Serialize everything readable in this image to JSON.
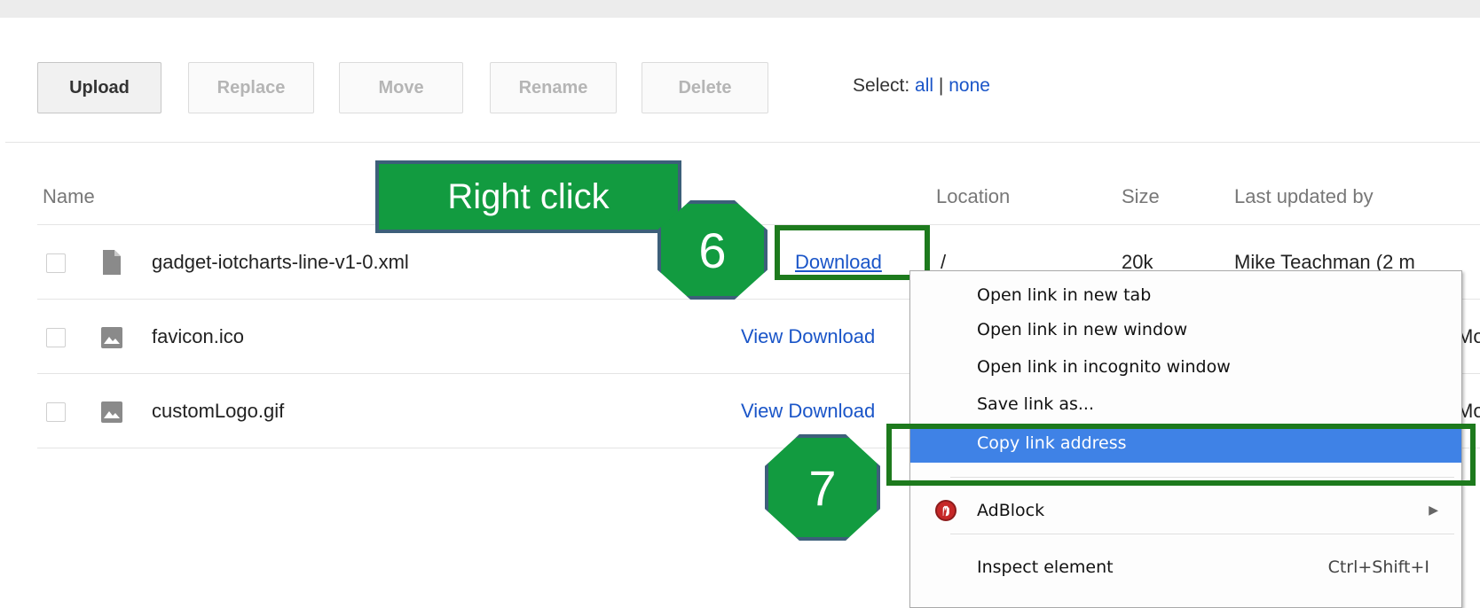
{
  "toolbar": {
    "upload_label": "Upload",
    "replace_label": "Replace",
    "move_label": "Move",
    "rename_label": "Rename",
    "delete_label": "Delete",
    "select_label": "Select:",
    "select_all": "all",
    "select_separator": "|",
    "select_none": "none"
  },
  "table": {
    "headers": {
      "name": "Name",
      "location": "Location",
      "size": "Size",
      "last_updated_by": "Last updated by"
    },
    "rows": [
      {
        "name": "gadget-iotcharts-line-v1-0.xml",
        "icon": "document-icon",
        "actions": "Download",
        "location": "/",
        "size": "20k",
        "last_updated_by": "Mike Teachman (2 m"
      },
      {
        "name": "favicon.ico",
        "icon": "image-icon",
        "actions": "View Download",
        "location": "",
        "size": "",
        "last_updated_by": "Mo"
      },
      {
        "name": "customLogo.gif",
        "icon": "image-icon",
        "actions": "View Download",
        "location": "",
        "size": "",
        "last_updated_by": "Mo"
      }
    ]
  },
  "annotations": {
    "right_click_label": "Right click",
    "step_6": "6",
    "step_7": "7"
  },
  "context_menu": {
    "items": [
      {
        "label": "Open link in new tab"
      },
      {
        "label": "Open link in new window"
      },
      {
        "label": "Open link in incognito window"
      },
      {
        "label": "Save link as..."
      },
      {
        "label": "Copy link address"
      },
      {
        "label": "AdBlock",
        "icon": "adblock-icon",
        "submenu": true
      },
      {
        "label": "Inspect element",
        "shortcut": "Ctrl+Shift+I"
      }
    ]
  },
  "colors": {
    "callout_green": "#129b40",
    "callout_border": "#3d5f7a",
    "highlight_green": "#1d7a1d",
    "link_blue": "#1a55c8",
    "menu_selected": "#3f82e6"
  }
}
